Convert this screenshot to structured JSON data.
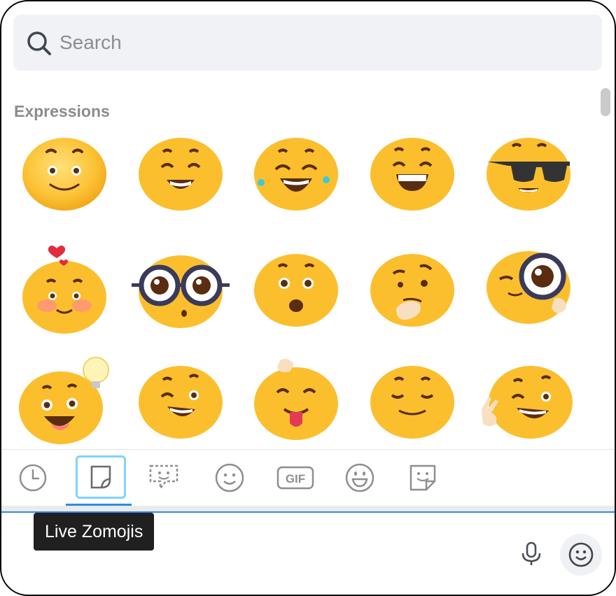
{
  "search": {
    "placeholder": "Search"
  },
  "section": {
    "title": "Expressions"
  },
  "emojis": [
    "smiling-face",
    "grinning-closed-eyes",
    "laughing-tears",
    "big-grin",
    "sunglasses",
    "blushing-heart",
    "nerd-glasses",
    "surprised",
    "thinking",
    "magnifying-glass",
    "idea-bulb",
    "winking",
    "tongue-out",
    "content",
    "peace-sign"
  ],
  "tabs": [
    {
      "name": "recent-clock-icon"
    },
    {
      "name": "live-zomojis-icon",
      "active": true
    },
    {
      "name": "speech-sticker-icon"
    },
    {
      "name": "emoji-face-icon"
    },
    {
      "name": "gif-icon",
      "text": "GIF"
    },
    {
      "name": "grin-face-icon"
    },
    {
      "name": "sticker-face-icon"
    }
  ],
  "tooltip": {
    "text": "Live Zomojis"
  },
  "colors": {
    "accent": "#2a8ce6",
    "active_tab_box": "#7fd3ff",
    "emoji": "#fbbf2e"
  }
}
